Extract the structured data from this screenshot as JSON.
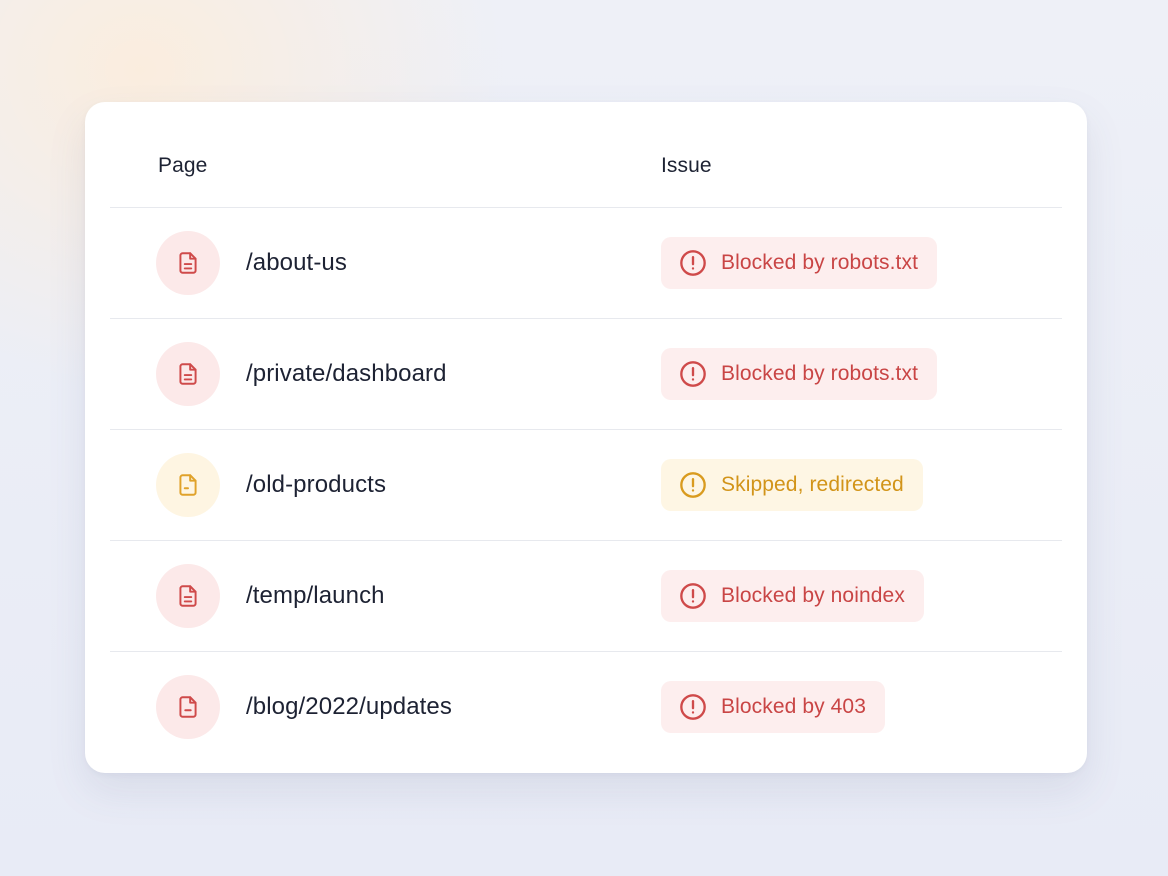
{
  "table": {
    "columns": {
      "page": "Page",
      "issue": "Issue"
    },
    "rows": [
      {
        "page": "/about-us",
        "issue": "Blocked by robots.txt",
        "severity": "error",
        "icon": "file-icon",
        "status_icon": "alert-circle-icon"
      },
      {
        "page": "/private/dashboard",
        "issue": "Blocked by robots.txt",
        "severity": "error",
        "icon": "file-icon",
        "status_icon": "alert-circle-icon"
      },
      {
        "page": "/old-products",
        "issue": "Skipped, redirected",
        "severity": "warning",
        "icon": "file-icon",
        "status_icon": "alert-circle-icon"
      },
      {
        "page": "/temp/launch",
        "issue": "Blocked by noindex",
        "severity": "error",
        "icon": "file-icon",
        "status_icon": "alert-circle-icon"
      },
      {
        "page": "/blog/2022/updates",
        "issue": "Blocked by 403",
        "severity": "error",
        "icon": "file-icon",
        "status_icon": "alert-circle-icon"
      }
    ]
  },
  "colors": {
    "error": "#cf4a4a",
    "error_bg": "#fdeeee",
    "warning": "#e0a22a",
    "warning_bg": "#fef6e4",
    "text": "#1d2233"
  }
}
